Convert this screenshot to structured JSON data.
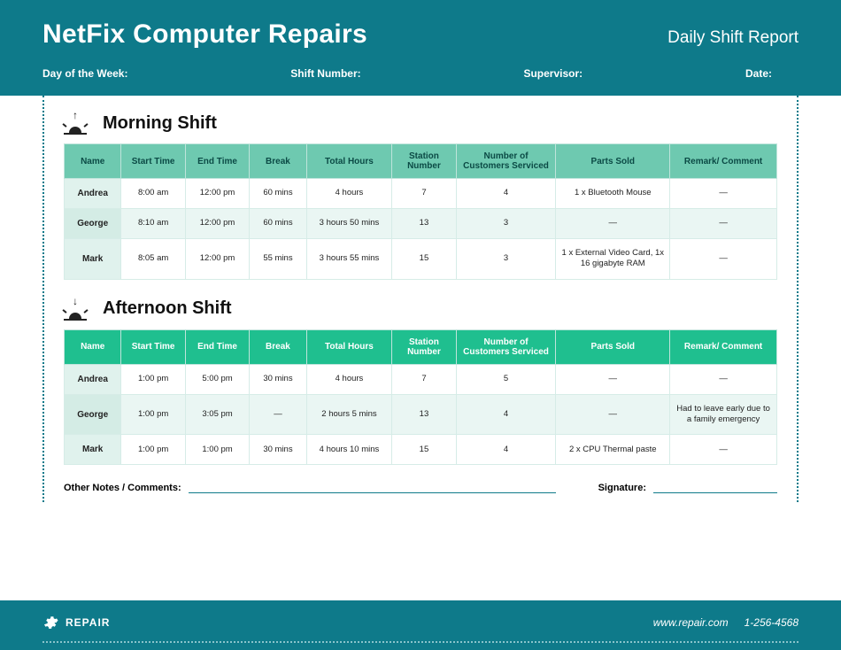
{
  "header": {
    "company_name": "NetFix Computer Repairs",
    "report_title": "Daily Shift Report",
    "fields": {
      "day_of_week": "Day of the Week:",
      "shift_number": "Shift Number:",
      "supervisor": "Supervisor:",
      "date": "Date:"
    }
  },
  "columns": {
    "name": "Name",
    "start": "Start Time",
    "end": "End Time",
    "break": "Break",
    "total": "Total Hours",
    "station": "Station Number",
    "customers": "Number of Customers Serviced",
    "parts": "Parts Sold",
    "remark": "Remark/ Comment"
  },
  "sections": [
    {
      "title": "Morning Shift",
      "arrow": "↑",
      "class": "morning",
      "rows": [
        {
          "name": "Andrea",
          "start": "8:00 am",
          "end": "12:00 pm",
          "break": "60 mins",
          "total": "4 hours",
          "station": "7",
          "customers": "4",
          "parts": "1 x Bluetooth Mouse",
          "remark": "—"
        },
        {
          "name": "George",
          "start": "8:10 am",
          "end": "12:00 pm",
          "break": "60 mins",
          "total": "3 hours 50 mins",
          "station": "13",
          "customers": "3",
          "parts": "—",
          "remark": "—"
        },
        {
          "name": "Mark",
          "start": "8:05 am",
          "end": "12:00 pm",
          "break": "55 mins",
          "total": "3 hours 55 mins",
          "station": "15",
          "customers": "3",
          "parts": "1 x External Video Card, 1x 16 gigabyte RAM",
          "remark": "—"
        }
      ]
    },
    {
      "title": "Afternoon Shift",
      "arrow": "↓",
      "class": "afternoon",
      "rows": [
        {
          "name": "Andrea",
          "start": "1:00 pm",
          "end": "5:00 pm",
          "break": "30 mins",
          "total": "4 hours",
          "station": "7",
          "customers": "5",
          "parts": "—",
          "remark": "—"
        },
        {
          "name": "George",
          "start": "1:00 pm",
          "end": "3:05 pm",
          "break": "—",
          "total": "2 hours 5 mins",
          "station": "13",
          "customers": "4",
          "parts": "—",
          "remark": "Had to leave early due to a family emergency"
        },
        {
          "name": "Mark",
          "start": "1:00 pm",
          "end": "1:00 pm",
          "break": "30 mins",
          "total": "4 hours 10 mins",
          "station": "15",
          "customers": "4",
          "parts": "2 x CPU Thermal paste",
          "remark": "—"
        }
      ]
    }
  ],
  "notes": {
    "label": "Other Notes / Comments:",
    "signature_label": "Signature:"
  },
  "footer": {
    "brand": "REPAIR",
    "website": "www.repair.com",
    "phone": "1-256-4568"
  }
}
